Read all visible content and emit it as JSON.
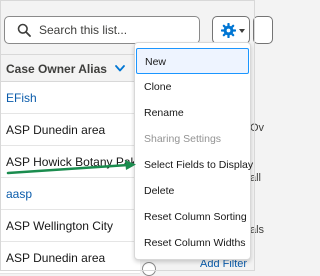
{
  "search": {
    "placeholder": "Search this list..."
  },
  "table": {
    "column_header": "Case Owner Alias",
    "rows": [
      "EFish",
      "ASP Dunedin area",
      "ASP Howick Botany Paku...",
      "aasp",
      "ASP Wellington City",
      "ASP Dunedin area"
    ]
  },
  "side_fragments": [
    "Ov",
    "all",
    "als",
    "Add Filter"
  ],
  "menu": {
    "items": [
      "New",
      "Clone",
      "Rename",
      "Sharing Settings",
      "Select Fields to Display",
      "Delete",
      "Reset Column Sorting",
      "Reset Column Widths"
    ]
  },
  "colors": {
    "link": "#0b5cab",
    "accent": "#1b96ff",
    "arrow": "#1a8c4e"
  },
  "icons": [
    "search-icon",
    "gear-icon",
    "caret-down-icon",
    "chevron-down-icon"
  ]
}
